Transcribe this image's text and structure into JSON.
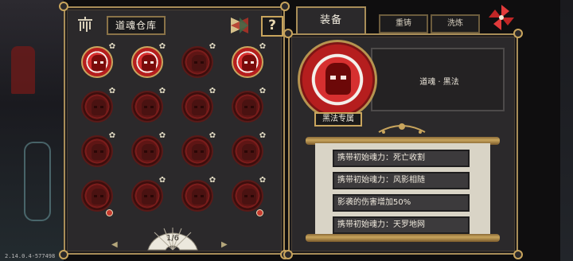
{
  "version": "2.14.0.4-577498",
  "storage": {
    "title": "道魂仓库",
    "help_label": "?",
    "page_indicator": "1/6",
    "slots": [
      {
        "lit": true,
        "star": true,
        "lock": false
      },
      {
        "lit": true,
        "star": true,
        "lock": false
      },
      {
        "lit": false,
        "star": true,
        "lock": false
      },
      {
        "lit": true,
        "star": true,
        "lock": false
      },
      {
        "lit": false,
        "star": true,
        "lock": false
      },
      {
        "lit": false,
        "star": true,
        "lock": false
      },
      {
        "lit": false,
        "star": true,
        "lock": false
      },
      {
        "lit": false,
        "star": true,
        "lock": false
      },
      {
        "lit": false,
        "star": true,
        "lock": false
      },
      {
        "lit": false,
        "star": true,
        "lock": false
      },
      {
        "lit": false,
        "star": true,
        "lock": false
      },
      {
        "lit": false,
        "star": true,
        "lock": false
      },
      {
        "lit": false,
        "star": false,
        "lock": true
      },
      {
        "lit": false,
        "star": true,
        "lock": false
      },
      {
        "lit": false,
        "star": true,
        "lock": false
      },
      {
        "lit": false,
        "star": true,
        "lock": true
      }
    ]
  },
  "tabs": {
    "equip": "装备",
    "reforge": "重铸",
    "wash": "洗炼"
  },
  "equipped": {
    "name": "道魂 · 黑法",
    "badge": "黑法专属",
    "affixes": [
      "携带初始魂力：死亡收割",
      "携带初始魂力：风影相随",
      "影袭的伤害增加50%",
      "携带初始魂力：天罗地网"
    ]
  },
  "icons": {
    "chime": "wind-chime-icon",
    "sort": "sort-toggle-icon",
    "close": "pinwheel-close-icon"
  },
  "colors": {
    "panel": "#2b292b",
    "gold_border": "#a88d58",
    "soul_red": "#d63030",
    "paper": "#d9d4c6"
  }
}
